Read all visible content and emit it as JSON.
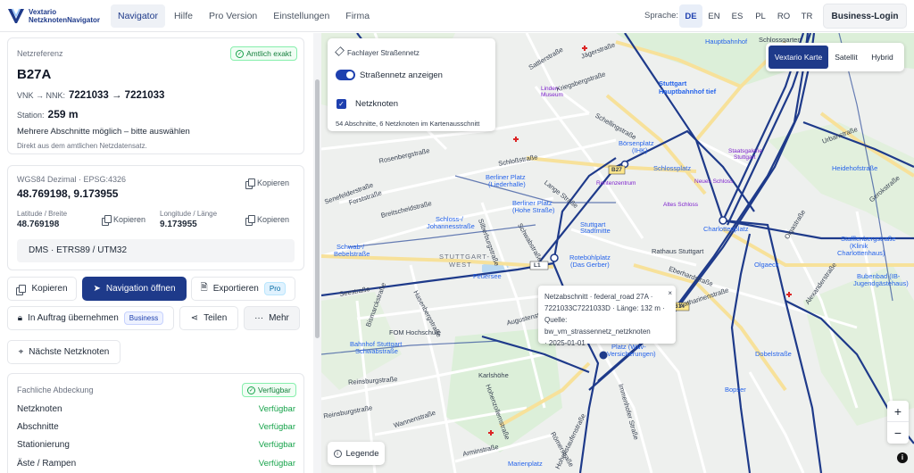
{
  "app": {
    "logo_line1": "Vextario",
    "logo_line2": "NetzknotenNavigator"
  },
  "nav": {
    "items": [
      {
        "label": "Navigator",
        "active": true
      },
      {
        "label": "Hilfe"
      },
      {
        "label": "Pro Version"
      },
      {
        "label": "Einstellungen"
      },
      {
        "label": "Firma"
      }
    ],
    "language_label": "Sprache:",
    "languages": [
      "DE",
      "EN",
      "ES",
      "PL",
      "RO",
      "TR"
    ],
    "active_language": "DE",
    "login_label": "Business-Login"
  },
  "reference": {
    "label": "Netzreferenz",
    "badge": "Amtlich exakt",
    "road": "B27A",
    "vnk_label": "VNK → NNK:",
    "vnk_value": "7221033 → 7221033",
    "station_label": "Station:",
    "station_value": "259 m",
    "hint": "Mehrere Abschnitte möglich – bitte auswählen",
    "source_note": "Direkt aus dem amtlichen Netzdatensatz."
  },
  "coords": {
    "system_label": "WGS84 Dezimal · EPSG:4326",
    "copy_label": "Kopieren",
    "value": "48.769198, 9.173955",
    "lat_label": "Latitude / Breite",
    "lat_value": "48.769198",
    "lon_label": "Longitude / Länge",
    "lon_value": "9.173955",
    "format_button": "DMS · ETRS89 / UTM32"
  },
  "actions": {
    "copy": "Kopieren",
    "navigate": "Navigation öffnen",
    "export": "Exportieren",
    "export_pill": "Pro",
    "assign": "In Auftrag übernehmen",
    "assign_pill": "Business",
    "share": "Teilen",
    "more": "Mehr",
    "nearest": "Nächste Netzknoten"
  },
  "coverage": {
    "label": "Fachliche Abdeckung",
    "badge": "Verfügbar",
    "rows": [
      {
        "name": "Netzknoten",
        "status": "Verfügbar"
      },
      {
        "name": "Abschnitte",
        "status": "Verfügbar"
      },
      {
        "name": "Stationierung",
        "status": "Verfügbar"
      },
      {
        "name": "Äste / Rampen",
        "status": "Verfügbar"
      }
    ]
  },
  "layer": {
    "title": "Fachlayer Straßennetz",
    "toggle_label": "Straßennetz anzeigen",
    "checkbox_label": "Netzknoten",
    "summary": "54 Abschnitte, 6 Netzknoten im Kartenausschnitt"
  },
  "map_types": {
    "options": [
      "Vextario Karte",
      "Satellit",
      "Hybrid"
    ],
    "active": "Vextario Karte"
  },
  "popup": {
    "line1": "Netzabschnitt · federal_road 27A ·",
    "line2": "7221033C7221033D · Länge: 132 m ·",
    "line3": "Quelle: bw_vm_strassennetz_netzknoten",
    "line4": "· 2025-01-01",
    "close": "×"
  },
  "map": {
    "legend_label": "Legende",
    "zoom_in": "+",
    "zoom_out": "−",
    "info": "i",
    "labels": [
      {
        "text": "Hauptbahnhof",
        "cls": "poi"
      },
      {
        "text": "Schlossgarten",
        "cls": ""
      },
      {
        "text": "Stuttgart",
        "cls": "poi"
      },
      {
        "text": "Hauptbahnhof tief",
        "cls": "poi"
      },
      {
        "text": "Linden-",
        "cls": "poi-purple"
      },
      {
        "text": "Museum",
        "cls": "poi-purple"
      },
      {
        "text": "Börsenplatz",
        "cls": "poi"
      },
      {
        "text": "(IHK)",
        "cls": "poi"
      },
      {
        "text": "Staatsgalerie",
        "cls": "poi-purple"
      },
      {
        "text": "Stuttgart",
        "cls": "poi-purple"
      },
      {
        "text": "Heidehofstraße",
        "cls": "poi"
      },
      {
        "text": "Schlossplatz",
        "cls": "poi"
      },
      {
        "text": "Berliner Platz",
        "cls": "poi"
      },
      {
        "text": "(Liederhalle)",
        "cls": "poi"
      },
      {
        "text": "Rentenzentrum",
        "cls": "poi-purple"
      },
      {
        "text": "Neues Schloss",
        "cls": "poi-purple"
      },
      {
        "text": "Berliner Platz",
        "cls": "poi"
      },
      {
        "text": "(Hohe Straße)",
        "cls": "poi"
      },
      {
        "text": "Altes Schloss",
        "cls": "poi-purple"
      },
      {
        "text": "Charlottenplatz",
        "cls": "poi"
      },
      {
        "text": "Schloss-/",
        "cls": "poi"
      },
      {
        "text": "Johannesstraße",
        "cls": "poi"
      },
      {
        "text": "Stuttgart",
        "cls": "poi"
      },
      {
        "text": "Stadtmitte",
        "cls": "poi"
      },
      {
        "text": "Rathaus Stuttgart",
        "cls": ""
      },
      {
        "text": "Schwab-/",
        "cls": "poi"
      },
      {
        "text": "Bebelstraße",
        "cls": "poi"
      },
      {
        "text": "STUTTGART-",
        "cls": ""
      },
      {
        "text": "WEST",
        "cls": ""
      },
      {
        "text": "Rotebühlplatz",
        "cls": "poi"
      },
      {
        "text": "(Das Gerber)",
        "cls": "poi"
      },
      {
        "text": "Stafflenbergstraße",
        "cls": "poi"
      },
      {
        "text": "(Klinik",
        "cls": "poi"
      },
      {
        "text": "Charlottenhaus)",
        "cls": "poi"
      },
      {
        "text": "Olgaeck",
        "cls": "poi"
      },
      {
        "text": "Feuersee",
        "cls": "poi"
      },
      {
        "text": "Bubenbad (IB-",
        "cls": "poi"
      },
      {
        "text": "Jugendgästehaus)",
        "cls": "poi"
      },
      {
        "text": "FOM Hochschule",
        "cls": ""
      },
      {
        "text": "Bahnhof Stuttgart",
        "cls": "poi"
      },
      {
        "text": "Schwabstraße",
        "cls": "poi"
      },
      {
        "text": "Platz (Wüv-",
        "cls": "poi"
      },
      {
        "text": "Versicherungen)",
        "cls": "poi"
      },
      {
        "text": "Dobelstraße",
        "cls": "poi"
      },
      {
        "text": "Karlshöhe",
        "cls": ""
      },
      {
        "text": "Bopser",
        "cls": "poi"
      },
      {
        "text": "Marienplatz",
        "cls": "poi"
      },
      {
        "text": "Forststraße",
        "cls": ""
      },
      {
        "text": "Breitscheidstraße",
        "cls": ""
      },
      {
        "text": "Rosenbergstraße",
        "cls": ""
      },
      {
        "text": "Schloßstraße",
        "cls": ""
      },
      {
        "text": "Lange Straße",
        "cls": ""
      },
      {
        "text": "Kriegsbergstraße",
        "cls": ""
      },
      {
        "text": "Schellingstraße",
        "cls": ""
      },
      {
        "text": "Seestraße",
        "cls": ""
      },
      {
        "text": "Hasenbergstraße",
        "cls": ""
      },
      {
        "text": "Reinsburgstraße",
        "cls": ""
      },
      {
        "text": "Augustenstraße",
        "cls": ""
      },
      {
        "text": "Wannenstraße",
        "cls": ""
      },
      {
        "text": "Katharinenstraße",
        "cls": ""
      },
      {
        "text": "Olgastraße",
        "cls": ""
      },
      {
        "text": "Alexanderstraße",
        "cls": ""
      },
      {
        "text": "Eberhardstraße",
        "cls": ""
      },
      {
        "text": "Hohenstaufenstraße",
        "cls": ""
      },
      {
        "text": "Immenhofer Straße",
        "cls": ""
      },
      {
        "text": "Arminstraße",
        "cls": ""
      },
      {
        "text": "Römerstraße",
        "cls": ""
      },
      {
        "text": "Sattlerstraße",
        "cls": ""
      },
      {
        "text": "Urbanstraße",
        "cls": ""
      },
      {
        "text": "Gerokstraße",
        "cls": ""
      },
      {
        "text": "Silberburgstraße",
        "cls": ""
      },
      {
        "text": "Bismarckstraße",
        "cls": ""
      },
      {
        "text": "Senefelderstraße",
        "cls": ""
      },
      {
        "text": "Reinsburgstraße",
        "cls": ""
      },
      {
        "text": "Hohenzollernstraße",
        "cls": ""
      },
      {
        "text": "Schwabstraße",
        "cls": ""
      },
      {
        "text": "Jägerstraße",
        "cls": ""
      }
    ],
    "road_badges": [
      "B27",
      "B14",
      "L1"
    ]
  }
}
